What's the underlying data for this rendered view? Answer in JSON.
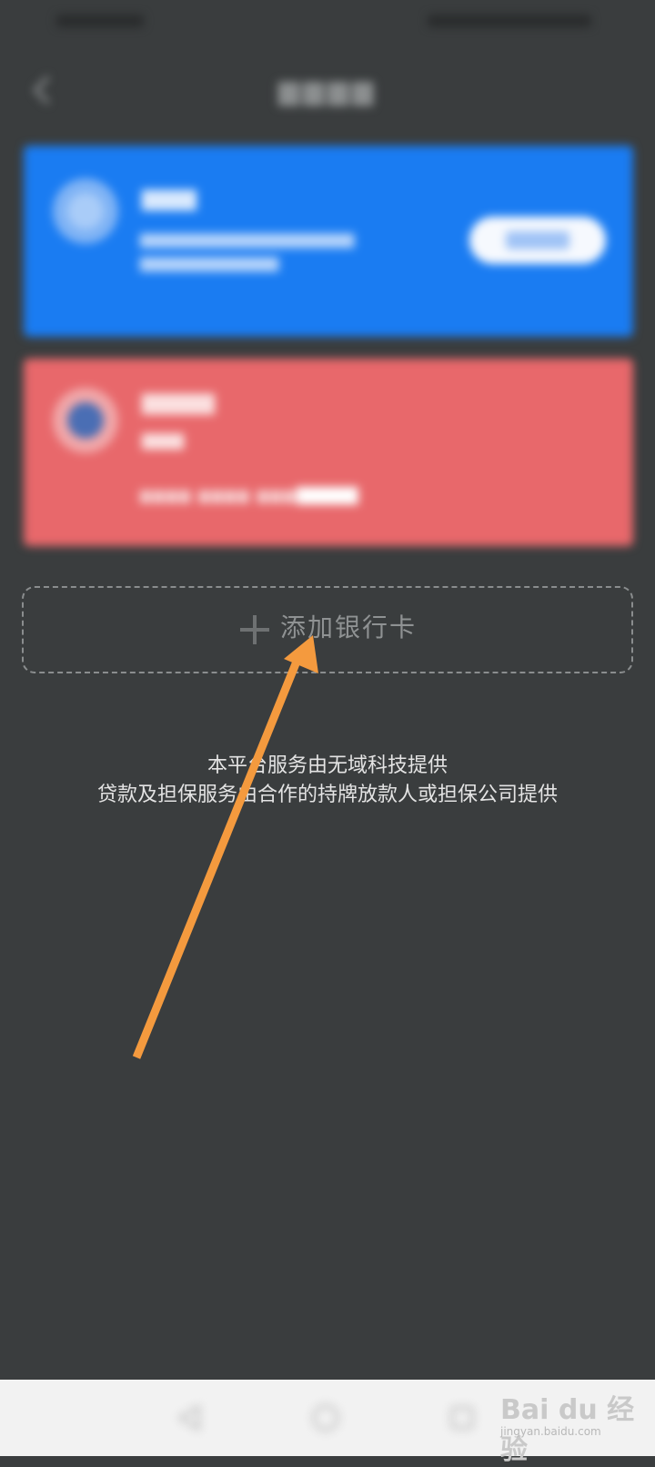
{
  "add_card": {
    "label": "添加银行卡"
  },
  "disclaimer": {
    "line1": "本平台服务由无域科技提供",
    "line2": "贷款及担保服务由合作的持牌放款人或担保公司提供"
  },
  "watermark": {
    "logo": "Bai du 经验",
    "url": "jingyan.baidu.com"
  },
  "icons": {
    "back": "back-arrow-icon",
    "plus": "plus-icon",
    "nav_back": "nav-back-icon",
    "nav_home": "nav-home-icon",
    "nav_recent": "nav-recent-icon"
  },
  "colors": {
    "background": "#3a3d3e",
    "card_blue": "#1a7cf2",
    "card_red": "#e8686b",
    "annotation_arrow": "#f49a3e"
  }
}
